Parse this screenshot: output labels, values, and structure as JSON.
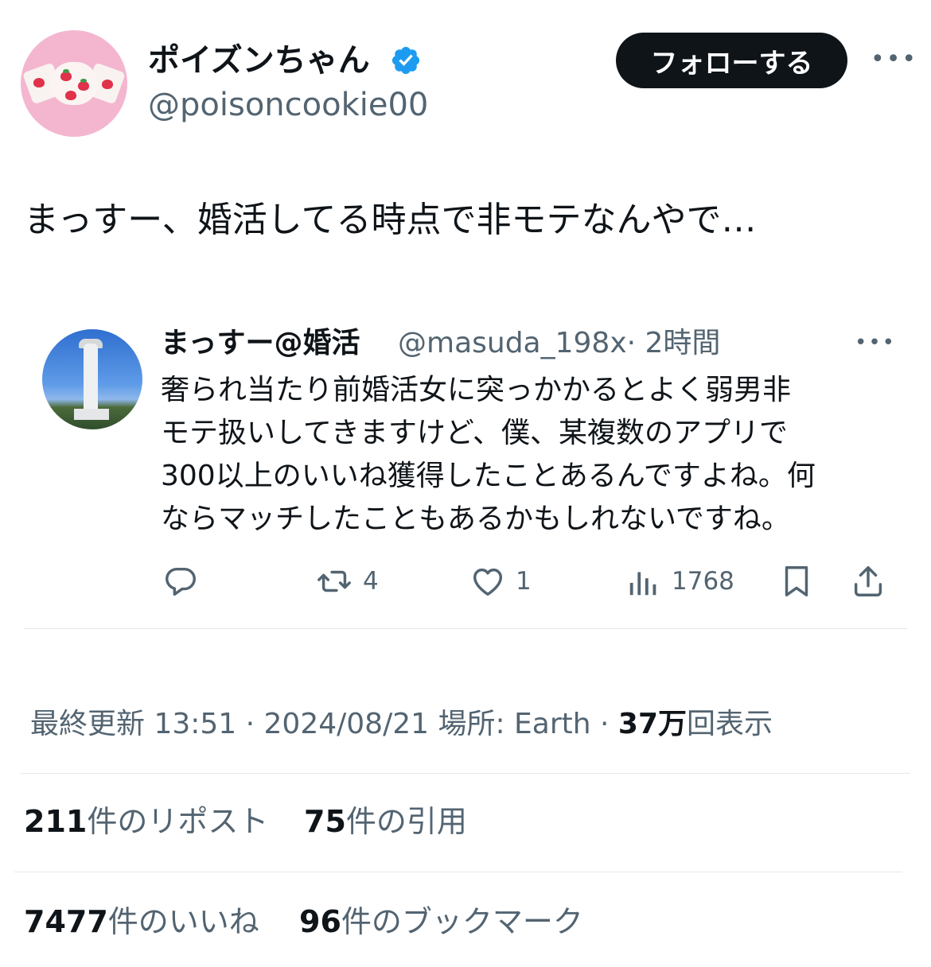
{
  "author": {
    "display_name": "ポイズンちゃん",
    "handle": "@poisoncookie00",
    "verified": true
  },
  "follow_label": "フォローする",
  "more_icon": "more-horizontal-icon",
  "tweet_text": "まっすー、婚活してる時点で非モテなんやで…",
  "quoted": {
    "display_name": "まっすー@婚活",
    "handle": "@masuda_198x",
    "time": "· 2時間",
    "text_lines": [
      "奢られ当たり前婚活女に突っかかるとよく弱男非",
      "モテ扱いしてきますけど、僕、某複数のアプリで",
      "300以上のいいね獲得したことあるんですよね。何",
      "ならマッチしたこともあるかもしれないですね。"
    ],
    "actions": {
      "reply_count": "",
      "repost_count": "4",
      "like_count": "1",
      "views_count": "1768"
    }
  },
  "meta": {
    "prefix": "最終更新 13:51 · 2024/08/21 場所: Earth · ",
    "views_bold": "37万",
    "views_suffix": "回表示"
  },
  "stats": {
    "reposts_num": "211",
    "reposts_label": "件のリポスト",
    "quotes_num": "75",
    "quotes_label": "件の引用",
    "likes_num": "7477",
    "likes_label": "件のいいね",
    "bookmarks_num": "96",
    "bookmarks_label": "件のブックマーク"
  },
  "colors": {
    "text": "#0f1419",
    "secondary": "#536471",
    "verified": "#1d9bf0",
    "button_bg": "#0f1419",
    "divider": "#e6e9eb"
  }
}
